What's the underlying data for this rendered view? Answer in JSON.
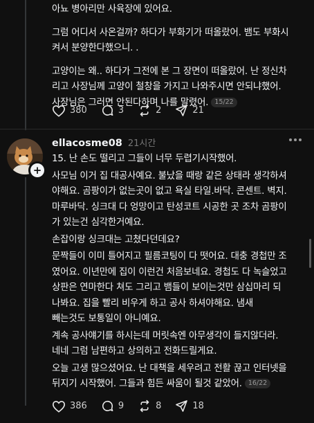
{
  "post1": {
    "lines": [
      "아뇨 병아리만 사육장에 있어요.",
      "그럼 어디서 사온걸까? 하다가 부화기가 떠올랐어. 뱀도 부화시",
      "켜서 분양한다했으니. .",
      "고양이는 왜.. 하다가 그전에 본 그 장면이 떠올랐어. 난 정신차",
      "리고 사장님께 고양이 철창을 가지고 나와주시면 안되냐했어.",
      "사장님은 그러면 안된다하며 나를 말렸어."
    ],
    "page_badge": "15/22",
    "likes": "380",
    "replies": "3",
    "reposts": "2",
    "shares": "21"
  },
  "post2": {
    "username": "ellacosme08",
    "time": "21시간",
    "lines": [
      "15. 난 손도 떨리고 그들이 너무 두렵기시작했어.",
      "사모님 이거 집 대공사예요. 불났을 때랑 같은 상태라 생각하셔",
      "야해요. 곰팡이가 없는곳이 없고 욕실 타일.바닥. 콘센트. 벽지.",
      "마루바닥. 싱크대 다 엉망이고 탄성코트 시공한 곳 조차 곰팡이",
      "가 있는건 심각한거예요.",
      "손잡이랑 싱크대는 고쳤다던데요?",
      "문짝들이 이미 틀어지고 필름코팅이 다 떳어요. 대충 경첩만 조",
      "였어요. 이년만에 집이 이런건 처음보네요. 경첩도 다 녹슬었고",
      "상판은 연마한다 쳐도 그리고 뱀들이 보이는것만 삼십마리 되",
      "나봐요. 집을 빨리 비우게 하고 공사 하셔야해요. 냄새",
      "빼는것도 보통일이 아니예요.",
      "계속 공사얘기를 하시는데 머릿속엔 아무생각이 들지않더라.",
      "네네 그럼 남편하고 상의하고 전화드릴게요.",
      "오늘 고생 많으셨어요. 난 대책을 세우려고 전활 끊고 인터넷을",
      "뒤지기 시작했어. 그들과 힘든 싸움이 될것 같았어."
    ],
    "page_badge": "16/22",
    "likes": "386",
    "replies": "9",
    "reposts": "8",
    "shares": "18"
  },
  "icons": [
    "heart-icon",
    "comment-icon",
    "repost-icon",
    "share-icon",
    "more-icon",
    "add-icon"
  ]
}
